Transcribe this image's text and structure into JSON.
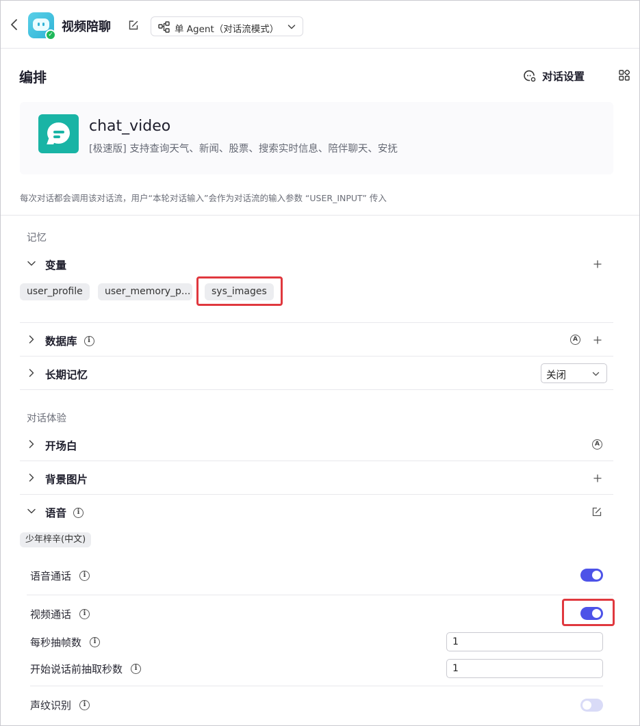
{
  "header": {
    "app_title": "视频陪聊",
    "mode_label": "单 Agent（对话流模式）"
  },
  "section": {
    "title": "编排",
    "chat_settings_label": "对话设置"
  },
  "workflow": {
    "name": "chat_video",
    "description": "[极速版] 支持查询天气、新闻、股票、搜索实时信息、陪伴聊天、安抚",
    "hint": "每次对话都会调用该对话流，用户“本轮对话输入”会作为对话流的输入参数 “USER_INPUT” 传入"
  },
  "memory": {
    "group_label": "记忆",
    "variables": {
      "title": "变量",
      "tags": [
        "user_profile",
        "user_memory_p...",
        "sys_images"
      ]
    },
    "database": {
      "title": "数据库"
    },
    "long_term": {
      "title": "长期记忆",
      "value": "关闭"
    }
  },
  "experience": {
    "group_label": "对话体验",
    "opening": {
      "title": "开场白"
    },
    "background": {
      "title": "背景图片"
    },
    "voice": {
      "title": "语音",
      "voice_tag": "少年梓辛(中文)",
      "voice_call": {
        "label": "语音通话",
        "enabled": true
      },
      "video_call": {
        "label": "视频通话",
        "enabled": true,
        "fps_label": "每秒抽帧数",
        "fps_value": "1",
        "pre_seconds_label": "开始说话前抽取秒数",
        "pre_seconds_value": "1"
      },
      "voiceprint": {
        "label": "声纹识别",
        "enabled": false
      }
    }
  },
  "colors": {
    "accent": "#4d53e8",
    "highlight": "#e0383e",
    "workflow_icon": "#19b4a5"
  }
}
